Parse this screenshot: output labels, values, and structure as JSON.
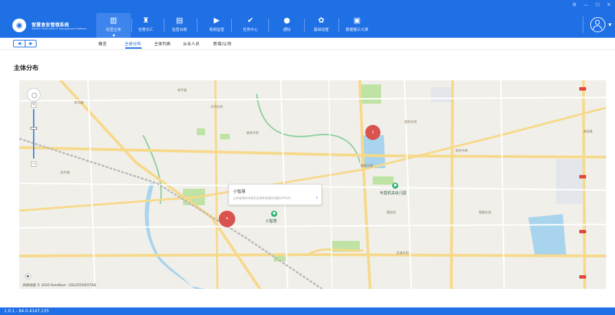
{
  "brand": {
    "logo_glyph": "◉",
    "name": "智慧食安管理系统",
    "subtitle": "SMART FOOD SAFETY Management Platform"
  },
  "nav": [
    {
      "icon": "building-icon",
      "label": "经营主体",
      "active": true
    },
    {
      "icon": "alarm-icon",
      "label": "告警总汇"
    },
    {
      "icon": "ledger-icon",
      "label": "监管台账"
    },
    {
      "icon": "video-icon",
      "label": "视频监管"
    },
    {
      "icon": "task-icon",
      "label": "任务中心"
    },
    {
      "icon": "notice-icon",
      "label": "通知"
    },
    {
      "icon": "gear-icon",
      "label": "基础设置"
    },
    {
      "icon": "dashboard-icon",
      "label": "数据展示大屏"
    }
  ],
  "window_controls": {
    "settings": "⚙",
    "minimize": "—",
    "maximize": "☐",
    "close": "✕"
  },
  "subnav": {
    "prev": "◀",
    "next": "▶",
    "tabs": [
      "概览",
      "主体分布",
      "主体列表",
      "从业人员",
      "新增/认领"
    ],
    "active_index": 1
  },
  "page": {
    "title": "主体分布"
  },
  "map": {
    "zoom_in": "+",
    "zoom_out": "−",
    "clusters": [
      {
        "count": "2"
      },
      {
        "count": "4"
      }
    ],
    "popup": {
      "title": "小智慧",
      "address": "山东省潍坊市昌乐县城关街道恒洲路129号大...",
      "arrow": "›"
    },
    "pois": [
      {
        "name": "小智慧"
      },
      {
        "name": "市直机关幼儿园"
      }
    ],
    "road_labels": [
      "东风东街",
      "福寿东街",
      "胜利东街",
      "樱桃东路",
      "宝通东街",
      "潍安路",
      "新华路",
      "和平路",
      "四平路",
      "樱前街",
      "健康东街",
      "潍县中路"
    ],
    "copyright": "高德地图 © 2020 AutoNavi - GS(2019)6379号",
    "colors": {
      "cluster": "#d9534f",
      "water": "#a8d4ee",
      "green": "#bfe3a5",
      "road": "#f6d98a"
    }
  },
  "status": {
    "version": "1.0.1 - 84.0.4147.135"
  },
  "colors": {
    "primary": "#1f6fe5"
  }
}
